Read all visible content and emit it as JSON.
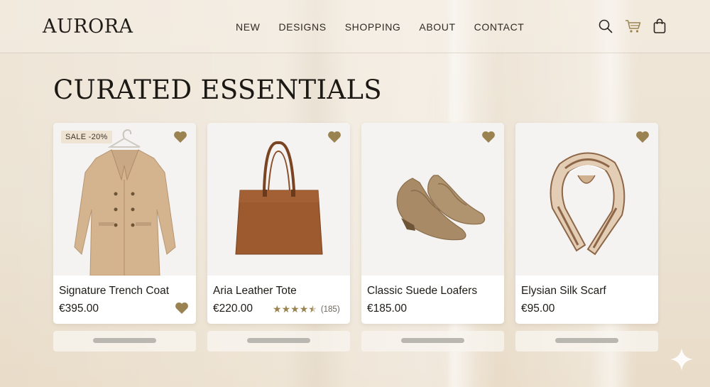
{
  "brand": {
    "name": "AURORA"
  },
  "nav": {
    "items": [
      "NEW",
      "DESIGNS",
      "SHOPPING",
      "ABOUT",
      "CONTACT"
    ]
  },
  "header_icons": [
    "search-icon",
    "cart-icon",
    "bag-icon"
  ],
  "page": {
    "title": "CURATED ESSENTIALS"
  },
  "colors": {
    "accent": "#9a8350",
    "card_bg": "#ffffff",
    "page_bg": "#ece3d4"
  },
  "products": [
    {
      "name": "Signature Trench Coat",
      "price": "€395.00",
      "badge": "SALE -20%",
      "image_icon": "trench-coat-image"
    },
    {
      "name": "Aria Leather Tote",
      "price": "€220.00",
      "rating": 4.5,
      "stars": "★★★★★",
      "reviews": "(185)",
      "image_icon": "tote-bag-image"
    },
    {
      "name": "Classic Suede Loafers",
      "price": "€185.00",
      "image_icon": "loafers-image"
    },
    {
      "name": "Elysian Silk Scarf",
      "price": "€95.00",
      "image_icon": "silk-scarf-image"
    }
  ]
}
